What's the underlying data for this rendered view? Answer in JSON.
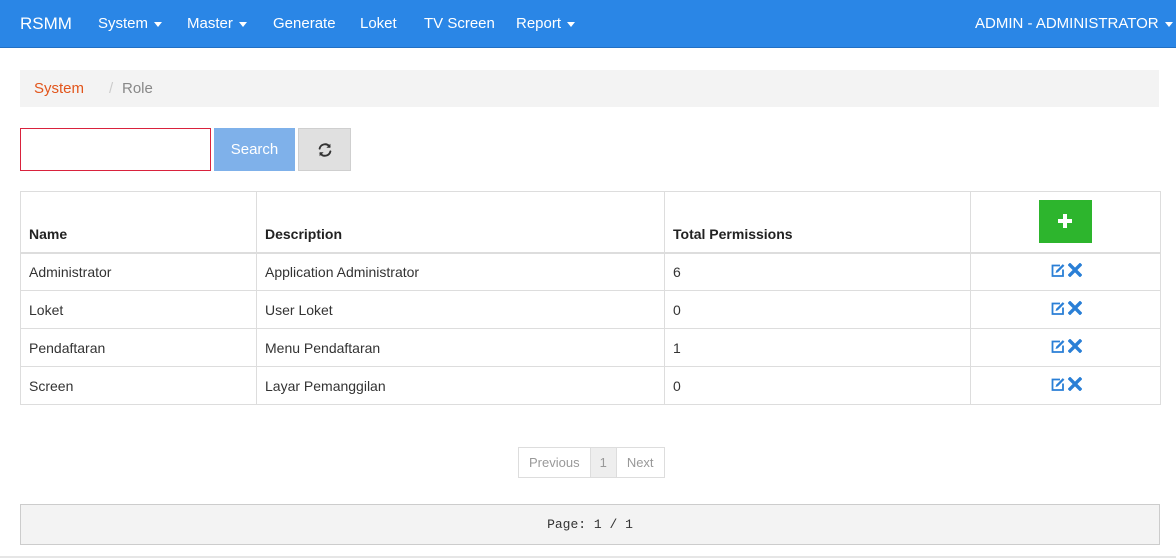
{
  "navbar": {
    "brand": "RSMM",
    "items": [
      {
        "label": "System",
        "dropdown": true
      },
      {
        "label": "Master",
        "dropdown": true
      },
      {
        "label": "Generate",
        "dropdown": false
      },
      {
        "label": "Loket",
        "dropdown": false
      },
      {
        "label": "TV Screen",
        "dropdown": false
      },
      {
        "label": "Report",
        "dropdown": true
      }
    ],
    "user": {
      "label": "ADMIN - ADMINISTRATOR",
      "dropdown": true
    }
  },
  "breadcrumb": {
    "parent": "System",
    "separator": "/",
    "current": "Role"
  },
  "search": {
    "value": "",
    "placeholder": "",
    "button_label": "Search",
    "refresh_icon": "refresh-icon"
  },
  "table": {
    "headers": [
      "Name",
      "Description",
      "Total Permissions",
      ""
    ],
    "add_icon": "plus-icon",
    "rows": [
      {
        "name": "Administrator",
        "description": "Application Administrator",
        "total": "6"
      },
      {
        "name": "Loket",
        "description": "User Loket",
        "total": "0"
      },
      {
        "name": "Pendaftaran",
        "description": "Menu Pendaftaran",
        "total": "1"
      },
      {
        "name": "Screen",
        "description": "Layar Pemanggilan",
        "total": "0"
      }
    ],
    "row_actions": [
      "edit-icon",
      "delete-icon"
    ]
  },
  "pagination": {
    "previous": "Previous",
    "current": "1",
    "next": "Next"
  },
  "page_info": "Page: 1 / 1",
  "colors": {
    "navbar": "#2a86e6",
    "breadcrumb_link": "#e2551b",
    "search_button": "#7fb1ea",
    "add_button": "#2db52d",
    "action_icon": "#2a7fd6",
    "search_border": "#d9223d"
  }
}
